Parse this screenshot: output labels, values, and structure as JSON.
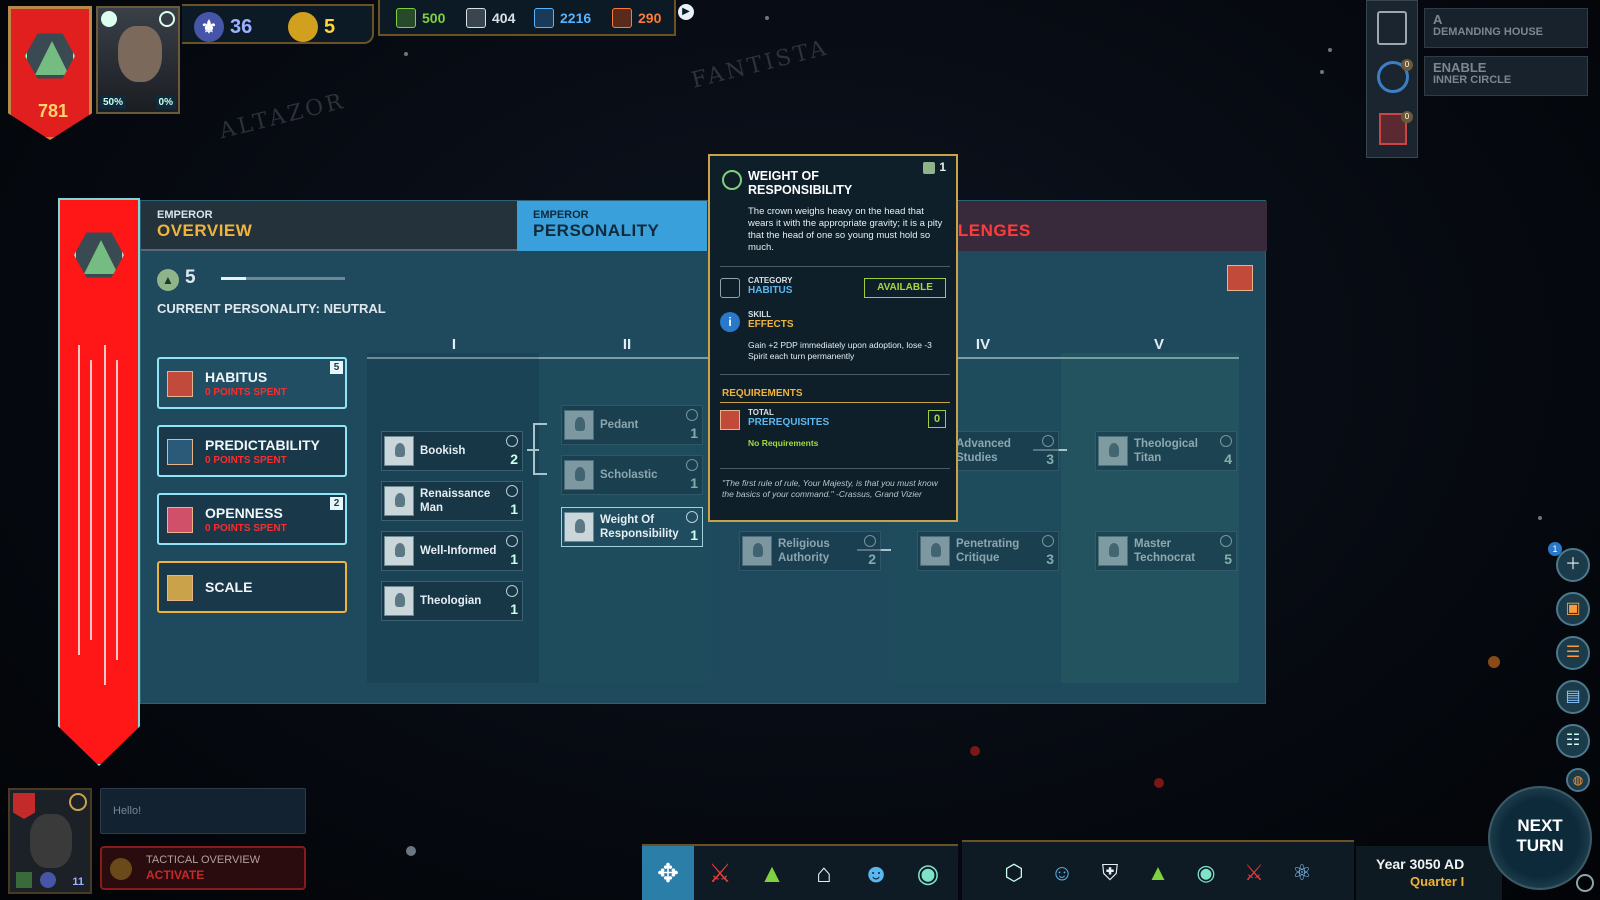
{
  "top_left": {
    "shield_value": "781",
    "portrait_stats": [
      "50%",
      "0%"
    ]
  },
  "resources_a": [
    {
      "value": "36",
      "color": "#9db1ff",
      "icon": "fleur-de-lis-icon"
    },
    {
      "value": "5",
      "color": "#ffd23a",
      "icon": "laurel-coin-icon"
    }
  ],
  "resources_b": [
    {
      "value": "500",
      "color": "#7fd13d",
      "icon": "industry-icon"
    },
    {
      "value": "404",
      "color": "#d9e1e6",
      "icon": "food-icon"
    },
    {
      "value": "2216",
      "color": "#56b3ff",
      "icon": "energy-icon"
    },
    {
      "value": "290",
      "color": "#ff7a3a",
      "icon": "research-icon"
    }
  ],
  "notes": [
    {
      "line1": "A",
      "line2": "DEMANDING HOUSE"
    },
    {
      "line1": "ENABLE",
      "line2": "INNER CIRCLE"
    }
  ],
  "note_badges": [
    "0",
    "0"
  ],
  "tabs": [
    {
      "small": "EMPEROR",
      "big": "OVERVIEW",
      "color": "#f0b43a"
    },
    {
      "small": "EMPEROR",
      "big": "PERSONALITY",
      "color": "#ffffff"
    },
    {
      "small": "R",
      "big": "LLENGES",
      "color": "#ff3b3b"
    }
  ],
  "personality": {
    "level": "5",
    "current_label": "CURRENT PERSONALITY: NEUTRAL"
  },
  "categories": [
    {
      "name": "HABITUS",
      "sub": "0 POINTS SPENT",
      "badge": "5"
    },
    {
      "name": "PREDICTABILITY",
      "sub": "0 POINTS SPENT",
      "badge": ""
    },
    {
      "name": "OPENNESS",
      "sub": "0 POINTS SPENT",
      "badge": "2"
    },
    {
      "name": "SCALE",
      "sub": "",
      "badge": ""
    }
  ],
  "columns": [
    "I",
    "II",
    "IV",
    "V"
  ],
  "skills": [
    {
      "name": "Bookish",
      "cost": "2"
    },
    {
      "name": "Renaissance Man",
      "cost": "1"
    },
    {
      "name": "Well-Informed",
      "cost": "1"
    },
    {
      "name": "Theologian",
      "cost": "1"
    },
    {
      "name": "Pedant",
      "cost": "1"
    },
    {
      "name": "Scholastic",
      "cost": "1"
    },
    {
      "name": "Weight Of Responsibility",
      "cost": "1"
    },
    {
      "name": "Religious Authority",
      "cost": "2"
    },
    {
      "name": "Advanced Studies",
      "cost": "3"
    },
    {
      "name": "Penetrating Critique",
      "cost": "3"
    },
    {
      "name": "Theological Titan",
      "cost": "4"
    },
    {
      "name": "Master Technocrat",
      "cost": "5"
    }
  ],
  "tooltip": {
    "title": "WEIGHT OF RESPONSIBILITY",
    "level": "1",
    "description": "The crown weighs heavy on the head that wears it with the appropriate gravity; it is a pity that the head of one so young must hold so much.",
    "category_label": "CATEGORY",
    "category_value": "HABITUS",
    "status": "AVAILABLE",
    "skill_label": "SKILL",
    "effects_label": "EFFECTS",
    "effects_text": "Gain +2 PDP immediately upon adoption, lose -3 Spirit each turn permanently",
    "requirements_title": "REQUIREMENTS",
    "total_label": "TOTAL",
    "prereq_label": "PREREQUISITES",
    "prereq_count": "0",
    "no_req": "No Requirements",
    "quote": "\"The first rule of rule, Your Majesty, is that you must know the basics of your command.\" -Crassus, Grand Vizier"
  },
  "bottom_left": {
    "chat_text": "Hello!",
    "tactical_line1": "TACTICAL OVERVIEW",
    "tactical_line2": "ACTIVATE",
    "portrait_count": "11"
  },
  "bottom_bar_icons": [
    "move-icon",
    "military-icon",
    "economy-icon",
    "senate-icon",
    "people-icon",
    "intel-icon"
  ],
  "bottom_bar_icons2": [
    "science-hex-icon",
    "emperor-icon",
    "defense-icon",
    "growth-icon",
    "vision-icon",
    "war-icon",
    "atom-icon"
  ],
  "calendar": {
    "year": "Year 3050 AD",
    "quarter": "Quarter I"
  },
  "next_turn": {
    "line1": "NEXT",
    "line2": "TURN"
  },
  "side_badge": "1"
}
